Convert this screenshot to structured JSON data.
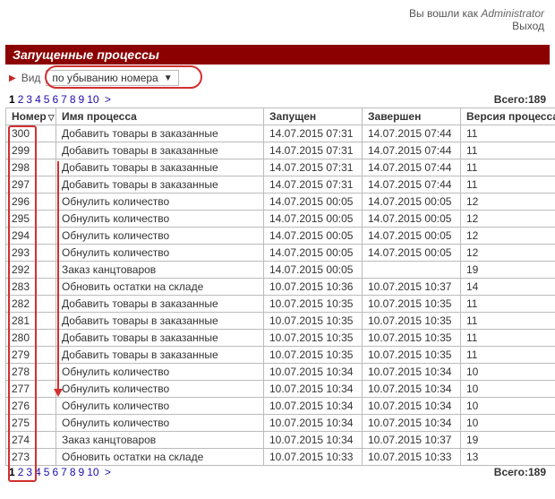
{
  "userbar": {
    "logged_in_as_label": "Вы вошли как",
    "username": "Administrator",
    "logout": "Выход"
  },
  "header": {
    "title": "Запущенные процессы"
  },
  "view": {
    "label": "Вид",
    "selected": "по убыванию номера"
  },
  "pager": {
    "current": "1",
    "pages": [
      "2",
      "3",
      "4",
      "5",
      "6",
      "7",
      "8",
      "9",
      "10"
    ],
    "next_symbol": ">",
    "total_label": "Всего:",
    "total_value": "189"
  },
  "table": {
    "columns": {
      "number": "Номер",
      "name": "Имя процесса",
      "started": "Запущен",
      "finished": "Завершен",
      "version": "Версия процесса"
    },
    "rows": [
      {
        "num": "300",
        "name": "Добавить товары в заказанные",
        "start": "14.07.2015 07:31",
        "end": "14.07.2015 07:44",
        "ver": "11"
      },
      {
        "num": "299",
        "name": "Добавить товары в заказанные",
        "start": "14.07.2015 07:31",
        "end": "14.07.2015 07:44",
        "ver": "11"
      },
      {
        "num": "298",
        "name": "Добавить товары в заказанные",
        "start": "14.07.2015 07:31",
        "end": "14.07.2015 07:44",
        "ver": "11"
      },
      {
        "num": "297",
        "name": "Добавить товары в заказанные",
        "start": "14.07.2015 07:31",
        "end": "14.07.2015 07:44",
        "ver": "11"
      },
      {
        "num": "296",
        "name": "Обнулить количество",
        "start": "14.07.2015 00:05",
        "end": "14.07.2015 00:05",
        "ver": "12"
      },
      {
        "num": "295",
        "name": "Обнулить количество",
        "start": "14.07.2015 00:05",
        "end": "14.07.2015 00:05",
        "ver": "12"
      },
      {
        "num": "294",
        "name": "Обнулить количество",
        "start": "14.07.2015 00:05",
        "end": "14.07.2015 00:05",
        "ver": "12"
      },
      {
        "num": "293",
        "name": "Обнулить количество",
        "start": "14.07.2015 00:05",
        "end": "14.07.2015 00:05",
        "ver": "12"
      },
      {
        "num": "292",
        "name": "Заказ канцтоваров",
        "start": "14.07.2015 00:05",
        "end": "",
        "ver": "19"
      },
      {
        "num": "283",
        "name": "Обновить остатки на складе",
        "start": "10.07.2015 10:36",
        "end": "10.07.2015 10:37",
        "ver": "14"
      },
      {
        "num": "282",
        "name": "Добавить товары в заказанные",
        "start": "10.07.2015 10:35",
        "end": "10.07.2015 10:35",
        "ver": "11"
      },
      {
        "num": "281",
        "name": "Добавить товары в заказанные",
        "start": "10.07.2015 10:35",
        "end": "10.07.2015 10:35",
        "ver": "11"
      },
      {
        "num": "280",
        "name": "Добавить товары в заказанные",
        "start": "10.07.2015 10:35",
        "end": "10.07.2015 10:35",
        "ver": "11"
      },
      {
        "num": "279",
        "name": "Добавить товары в заказанные",
        "start": "10.07.2015 10:35",
        "end": "10.07.2015 10:35",
        "ver": "11"
      },
      {
        "num": "278",
        "name": "Обнулить количество",
        "start": "10.07.2015 10:34",
        "end": "10.07.2015 10:34",
        "ver": "10"
      },
      {
        "num": "277",
        "name": "Обнулить количество",
        "start": "10.07.2015 10:34",
        "end": "10.07.2015 10:34",
        "ver": "10"
      },
      {
        "num": "276",
        "name": "Обнулить количество",
        "start": "10.07.2015 10:34",
        "end": "10.07.2015 10:34",
        "ver": "10"
      },
      {
        "num": "275",
        "name": "Обнулить количество",
        "start": "10.07.2015 10:34",
        "end": "10.07.2015 10:34",
        "ver": "10"
      },
      {
        "num": "274",
        "name": "Заказ канцтоваров",
        "start": "10.07.2015 10:34",
        "end": "10.07.2015 10:37",
        "ver": "19"
      },
      {
        "num": "273",
        "name": "Обновить остатки на складе",
        "start": "10.07.2015 10:33",
        "end": "10.07.2015 10:33",
        "ver": "13"
      }
    ]
  }
}
